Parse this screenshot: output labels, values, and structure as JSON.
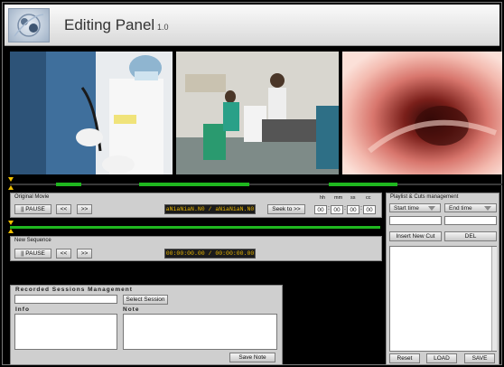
{
  "header": {
    "title": "Editing Panel",
    "version": "1.0"
  },
  "original_movie": {
    "label": "Original Movie",
    "pause_label": "|| PAUSE",
    "rewind_label": "<<",
    "forward_label": ">>",
    "timecode": "aNiaNiaN.N0 / aNiaNiaN.N0",
    "seek_label": "Seek to >>",
    "time_headers": {
      "hh": "hh",
      "mm": "mm",
      "ss": "ss",
      "cc": "cc"
    },
    "time_values": {
      "hh": "00",
      "mm": "00",
      "ss": "00",
      "cc": "00"
    }
  },
  "new_sequence": {
    "label": "New Sequence",
    "pause_label": "|| PAUSE",
    "rewind_label": "<<",
    "forward_label": ">>",
    "timecode": "00:00:00.00 / 00:00:00.00"
  },
  "recorded_sessions": {
    "title": "Recorded Sessions Management",
    "select_label": "Select Session",
    "info_label": "Info",
    "note_label": "Note",
    "save_note_label": "Save Note"
  },
  "playlist": {
    "title": "Playlist & Cuts management",
    "start_time_label": "Start time",
    "end_time_label": "End time",
    "insert_label": "Insert New Cut",
    "del_label": "DEL",
    "reset_label": "Reset",
    "load_label": "LOAD",
    "save_label": "SAVE"
  },
  "colors": {
    "timeline_green": "#1fb71f",
    "marker_yellow": "#f0c000",
    "timecode_text": "#e7b400"
  },
  "icons": [
    "logo-icon",
    "dropdown-arrow-icon",
    "timeline-marker-icon"
  ]
}
